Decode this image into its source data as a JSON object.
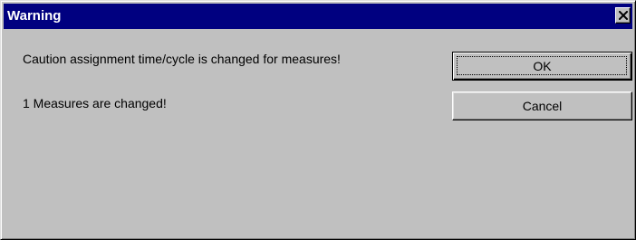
{
  "dialog": {
    "title": "Warning",
    "close_icon": "close-icon",
    "messages": [
      "Caution assignment time/cycle is changed for measures!",
      "1 Measures are changed!"
    ],
    "buttons": {
      "ok_label": "OK",
      "cancel_label": "Cancel"
    },
    "colors": {
      "title_bar": "#000080",
      "title_text": "#ffffff",
      "face": "#c0c0c0"
    }
  }
}
